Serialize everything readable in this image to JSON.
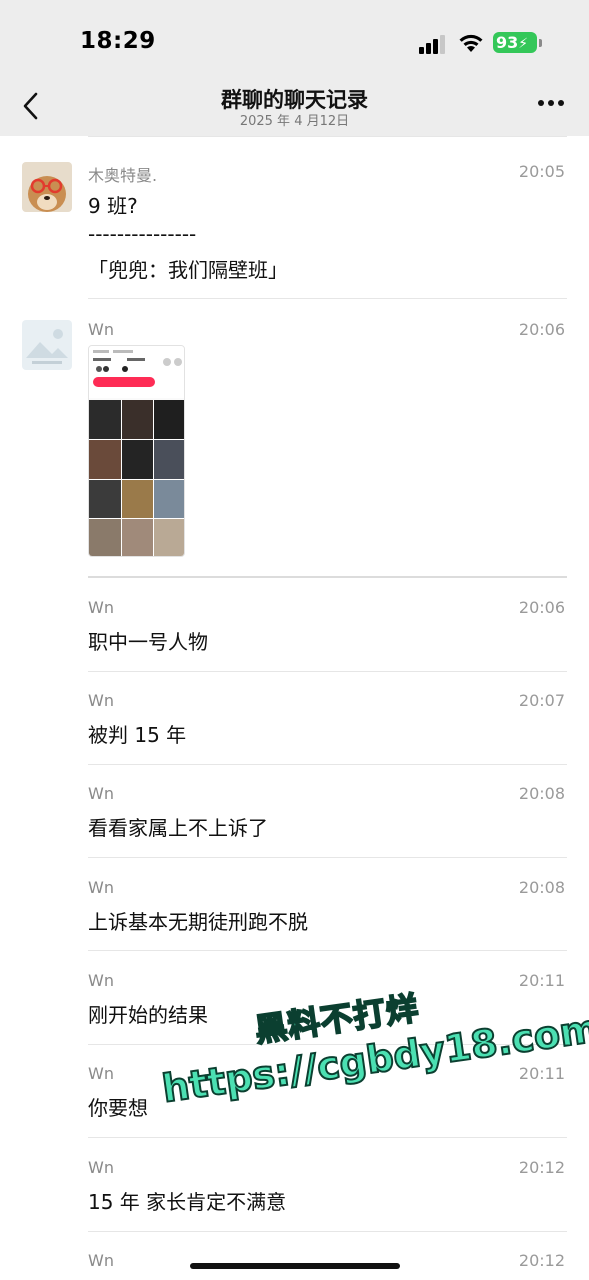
{
  "status_bar": {
    "time": "18:29",
    "battery": "93"
  },
  "nav": {
    "title": "群聊的聊天记录",
    "subtitle": "2025 年 4 月12日"
  },
  "messages": [
    {
      "sender": "木奥特曼.",
      "time": "20:05",
      "lines": [
        "9 班?",
        "---------------",
        "「兜兜：我们隔壁班」"
      ]
    },
    {
      "sender": "Wn",
      "time": "20:06",
      "image": true
    },
    {
      "sender": "Wn",
      "time": "20:06",
      "lines": [
        "职中一号人物"
      ]
    },
    {
      "sender": "Wn",
      "time": "20:07",
      "lines": [
        "被判 15 年"
      ]
    },
    {
      "sender": "Wn",
      "time": "20:08",
      "lines": [
        "看看家属上不上诉了"
      ]
    },
    {
      "sender": "Wn",
      "time": "20:08",
      "lines": [
        "上诉基本无期徒刑跑不脱"
      ]
    },
    {
      "sender": "Wn",
      "time": "20:11",
      "lines": [
        "刚开始的结果"
      ]
    },
    {
      "sender": "Wn",
      "time": "20:11",
      "lines": [
        "你要想"
      ]
    },
    {
      "sender": "Wn",
      "time": "20:12",
      "lines": [
        "15 年 家长肯定不满意"
      ]
    },
    {
      "sender": "Wn",
      "time": "20:12"
    }
  ],
  "watermark": {
    "line1": "黑料不打烊",
    "line2": "https://cgbdy18.com"
  },
  "colors": {
    "top_bar": "#ededed",
    "battery": "#34c759",
    "watermark": "#4be0b2",
    "divider": "#e6e6e6"
  }
}
